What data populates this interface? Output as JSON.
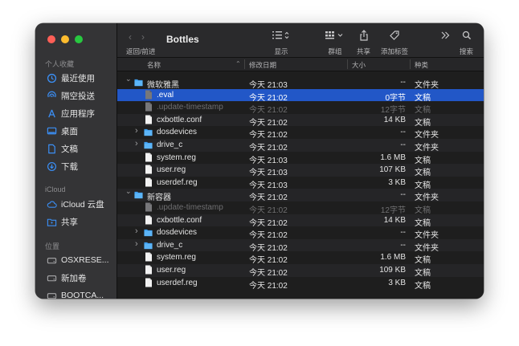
{
  "window": {
    "title": "Bottles"
  },
  "toolbar": {
    "nav_label": "返回/前进",
    "view_label": "显示",
    "group_label": "群组",
    "share_label": "共享",
    "tag_label": "添加标签",
    "search_label": "搜索"
  },
  "sidebar": {
    "sections": [
      {
        "title": "个人收藏",
        "items": [
          {
            "label": "最近使用",
            "icon": "clock-icon"
          },
          {
            "label": "隔空投送",
            "icon": "airdrop-icon"
          },
          {
            "label": "应用程序",
            "icon": "applications-icon"
          },
          {
            "label": "桌面",
            "icon": "desktop-icon"
          },
          {
            "label": "文稿",
            "icon": "document-icon"
          },
          {
            "label": "下载",
            "icon": "download-icon"
          }
        ]
      },
      {
        "title": "iCloud",
        "items": [
          {
            "label": "iCloud 云盘",
            "icon": "cloud-icon"
          },
          {
            "label": "共享",
            "icon": "shared-folder-icon"
          }
        ]
      },
      {
        "title": "位置",
        "items": [
          {
            "label": "OSXRESE...",
            "icon": "disk-icon"
          },
          {
            "label": "新加卷",
            "icon": "disk-icon"
          },
          {
            "label": "BOOTCA...",
            "icon": "disk-icon"
          }
        ]
      }
    ]
  },
  "columns": {
    "name": "名称",
    "date": "修改日期",
    "size": "大小",
    "kind": "种类"
  },
  "rows": [
    {
      "name": "微软雅黑",
      "date": "今天 21:03",
      "size": "--",
      "kind": "文件夹",
      "level": 0,
      "type": "folder",
      "expanded": true
    },
    {
      "name": ".eval",
      "date": "今天 21:02",
      "size": "0字节",
      "kind": "文稿",
      "level": 1,
      "type": "file",
      "selected": true,
      "hidden": true
    },
    {
      "name": ".update-timestamp",
      "date": "今天 21:02",
      "size": "12字节",
      "kind": "文稿",
      "level": 1,
      "type": "file",
      "hidden": true
    },
    {
      "name": "cxbottle.conf",
      "date": "今天 21:02",
      "size": "14 KB",
      "kind": "文稿",
      "level": 1,
      "type": "file"
    },
    {
      "name": "dosdevices",
      "date": "今天 21:02",
      "size": "--",
      "kind": "文件夹",
      "level": 1,
      "type": "folder",
      "expanded": false
    },
    {
      "name": "drive_c",
      "date": "今天 21:02",
      "size": "--",
      "kind": "文件夹",
      "level": 1,
      "type": "folder",
      "expanded": false
    },
    {
      "name": "system.reg",
      "date": "今天 21:03",
      "size": "1.6 MB",
      "kind": "文稿",
      "level": 1,
      "type": "file"
    },
    {
      "name": "user.reg",
      "date": "今天 21:03",
      "size": "107 KB",
      "kind": "文稿",
      "level": 1,
      "type": "file"
    },
    {
      "name": "userdef.reg",
      "date": "今天 21:03",
      "size": "3 KB",
      "kind": "文稿",
      "level": 1,
      "type": "file"
    },
    {
      "name": "新容器",
      "date": "今天 21:02",
      "size": "--",
      "kind": "文件夹",
      "level": 0,
      "type": "folder",
      "expanded": true
    },
    {
      "name": ".update-timestamp",
      "date": "今天 21:02",
      "size": "12字节",
      "kind": "文稿",
      "level": 1,
      "type": "file",
      "hidden": true
    },
    {
      "name": "cxbottle.conf",
      "date": "今天 21:02",
      "size": "14 KB",
      "kind": "文稿",
      "level": 1,
      "type": "file"
    },
    {
      "name": "dosdevices",
      "date": "今天 21:02",
      "size": "--",
      "kind": "文件夹",
      "level": 1,
      "type": "folder",
      "expanded": false
    },
    {
      "name": "drive_c",
      "date": "今天 21:02",
      "size": "--",
      "kind": "文件夹",
      "level": 1,
      "type": "folder",
      "expanded": false
    },
    {
      "name": "system.reg",
      "date": "今天 21:02",
      "size": "1.6 MB",
      "kind": "文稿",
      "level": 1,
      "type": "file"
    },
    {
      "name": "user.reg",
      "date": "今天 21:02",
      "size": "109 KB",
      "kind": "文稿",
      "level": 1,
      "type": "file"
    },
    {
      "name": "userdef.reg",
      "date": "今天 21:02",
      "size": "3 KB",
      "kind": "文稿",
      "level": 1,
      "type": "file"
    }
  ],
  "colors": {
    "accent": "#2257c7",
    "folder": "#3ea2f5",
    "sidebar_icon": "#3b8ff5"
  }
}
